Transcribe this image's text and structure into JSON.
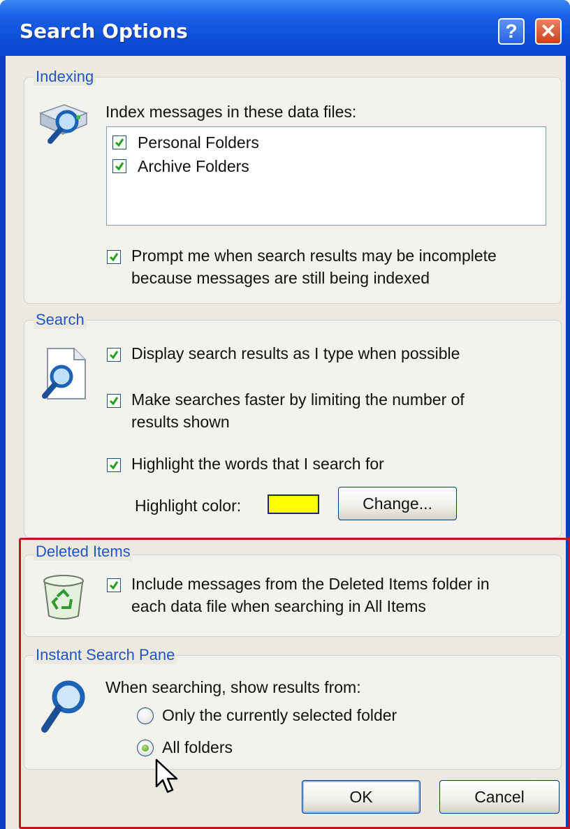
{
  "window": {
    "title": "Search Options",
    "help_glyph": "?",
    "close_glyph": "✕"
  },
  "indexing": {
    "group_label": "Indexing",
    "list_label": "Index messages in these data files:",
    "data_files": [
      {
        "label": "Personal Folders",
        "checked": true
      },
      {
        "label": "Archive Folders",
        "checked": true
      }
    ],
    "prompt_line1": "Prompt me when search results may be incomplete",
    "prompt_line2": "because messages are still being indexed",
    "prompt_checked": true,
    "icon": "index-magnifier-icon"
  },
  "search": {
    "group_label": "Search",
    "display_as_type": "Display search results as I type when possible",
    "limit_line1": "Make searches faster by limiting the number of",
    "limit_line2": "results shown",
    "highlight_words": "Highlight the words that I search for",
    "highlight_color_label": "Highlight color:",
    "highlight_color": "#ffff00",
    "change_button": "Change...",
    "icon": "document-search-icon"
  },
  "deleted_items": {
    "group_label": "Deleted Items",
    "include_line1": "Include messages from the Deleted Items folder in",
    "include_line2": "each data file when searching in All Items",
    "include_checked": true,
    "icon": "recycle-bin-icon"
  },
  "instant_search_pane": {
    "group_label": "Instant Search Pane",
    "prompt": "When searching, show results from:",
    "options": [
      {
        "label": "Only the currently selected folder",
        "selected": false
      },
      {
        "label": "All folders",
        "selected": true
      }
    ],
    "icon": "magnifier-icon"
  },
  "buttons": {
    "ok": "OK",
    "cancel": "Cancel"
  },
  "colors": {
    "title_bar": "#0a46cf",
    "group_label": "#1e56c4",
    "annotation_box": "#c0141e"
  }
}
